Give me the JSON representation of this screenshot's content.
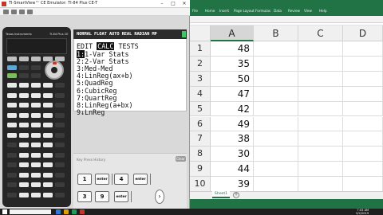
{
  "ti_emulator": {
    "window_title": "TI-SmartView™ CE Emulator: TI-84 Plus CE-T",
    "calculator_brand": "Texas Instruments",
    "calculator_model": "TI-84 Plus CE",
    "lcd": {
      "status_line": "NORMAL FLOAT AUTO REAL RADIAN MP",
      "tabs": [
        "EDIT",
        "CALC",
        "TESTS"
      ],
      "selected_tab": "CALC",
      "menu_items": [
        {
          "num": "1:",
          "label": "1-Var Stats"
        },
        {
          "num": "2:",
          "label": "2-Var Stats"
        },
        {
          "num": "3:",
          "label": "Med-Med"
        },
        {
          "num": "4:",
          "label": "LinReg(ax+b)"
        },
        {
          "num": "5:",
          "label": "QuadReg"
        },
        {
          "num": "6:",
          "label": "CubicReg"
        },
        {
          "num": "7:",
          "label": "QuartReg"
        },
        {
          "num": "8:",
          "label": "LinReg(a+bx)"
        },
        {
          "num": "9↓",
          "label": "LnReg"
        }
      ]
    },
    "key_history": {
      "label": "Key Press History",
      "clear_label": "Clear",
      "row1": [
        "1",
        "enter",
        "4",
        "enter"
      ],
      "row2": [
        "3",
        "9",
        "enter",
        "›"
      ]
    }
  },
  "excel": {
    "ribbon_tabs": [
      "File",
      "Home",
      "Insert",
      "Page Layout",
      "Formulas",
      "Data",
      "Review",
      "View",
      "Help"
    ],
    "columns": [
      "A",
      "B",
      "C",
      "D"
    ],
    "selected_column": "A",
    "rows": [
      {
        "row": "1",
        "A": "48"
      },
      {
        "row": "2",
        "A": "35"
      },
      {
        "row": "3",
        "A": "50"
      },
      {
        "row": "4",
        "A": "47"
      },
      {
        "row": "5",
        "A": "42"
      },
      {
        "row": "6",
        "A": "49"
      },
      {
        "row": "7",
        "A": "38"
      },
      {
        "row": "8",
        "A": "30"
      },
      {
        "row": "9",
        "A": "44"
      },
      {
        "row": "10",
        "A": "39"
      },
      {
        "row": "11",
        "A": ""
      }
    ],
    "sheet_tab": "Sheet1",
    "add_sheet": "+"
  },
  "taskbar": {
    "time": "7:03 AM",
    "date": "5/2/2019"
  },
  "colors": {
    "excel_green": "#217346",
    "lcd_highlight": "#111111",
    "battery_green": "#44c26a"
  }
}
